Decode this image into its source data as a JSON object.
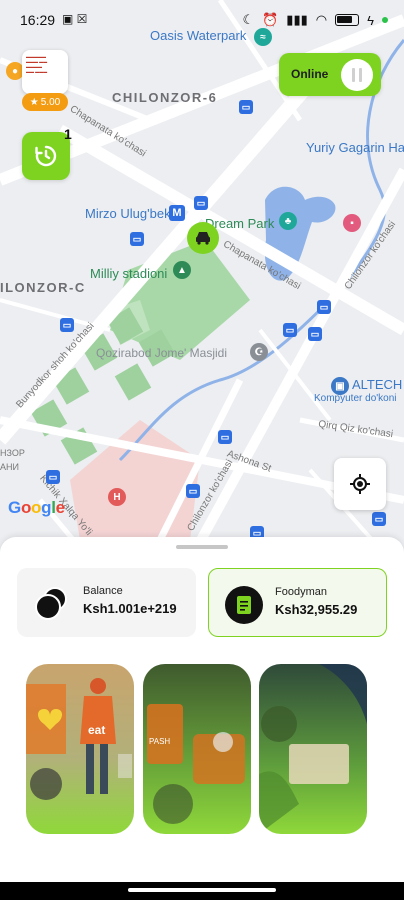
{
  "status_bar": {
    "time": "16:29",
    "icons": [
      "moon-icon",
      "alarm-icon",
      "signal-icon",
      "wifi-icon",
      "battery-icon",
      "charging-icon"
    ]
  },
  "map": {
    "labels": {
      "oasis": "Oasis Waterpark",
      "chilonzor6": "CHILONZOR-6",
      "chilonzorc": "ILONZOR-C",
      "yuriy": "Yuriy Gagarin Ha",
      "mirzo": "Mirzo Ulug'bek",
      "dream": "Dream Park",
      "milliy": "Milliy stadioni",
      "qozirabod": "Qozirabod Jome' Masjidi",
      "altech": "ALTECH",
      "altech_sub": "Kompyuter do'koni",
      "chapanata1": "Chapanata ko'chasi",
      "chapanata2": "Chapanata ko'chasi",
      "bunyodkor": "Bunyodkor shoh ko'chasi",
      "chilonzor_st": "Chilonzor ko'chasi",
      "chilonzor_st2": "Chilonzor ko'chasi",
      "qirq": "Qirq Qiz ko'chasi",
      "ashona": "Ashona St",
      "left1": "НЗОР",
      "left2": "АНИ",
      "kichik": "Kichik Xalqa Yo'li",
      "google": "Google"
    },
    "google_colors": [
      "#4285F4",
      "#EA4335",
      "#FBBC05",
      "#4285F4",
      "#34A853",
      "#EA4335"
    ]
  },
  "overlay": {
    "rating": "5.00",
    "history_count": "1",
    "online_label": "Online"
  },
  "sheet": {
    "balance": {
      "title": "Balance",
      "value": "Ksh1.001e+219"
    },
    "foodyman": {
      "title": "Foodyman",
      "value": "Ksh32,955.29"
    }
  },
  "colors": {
    "accent": "#7ed321",
    "rating": "#f39c12"
  }
}
